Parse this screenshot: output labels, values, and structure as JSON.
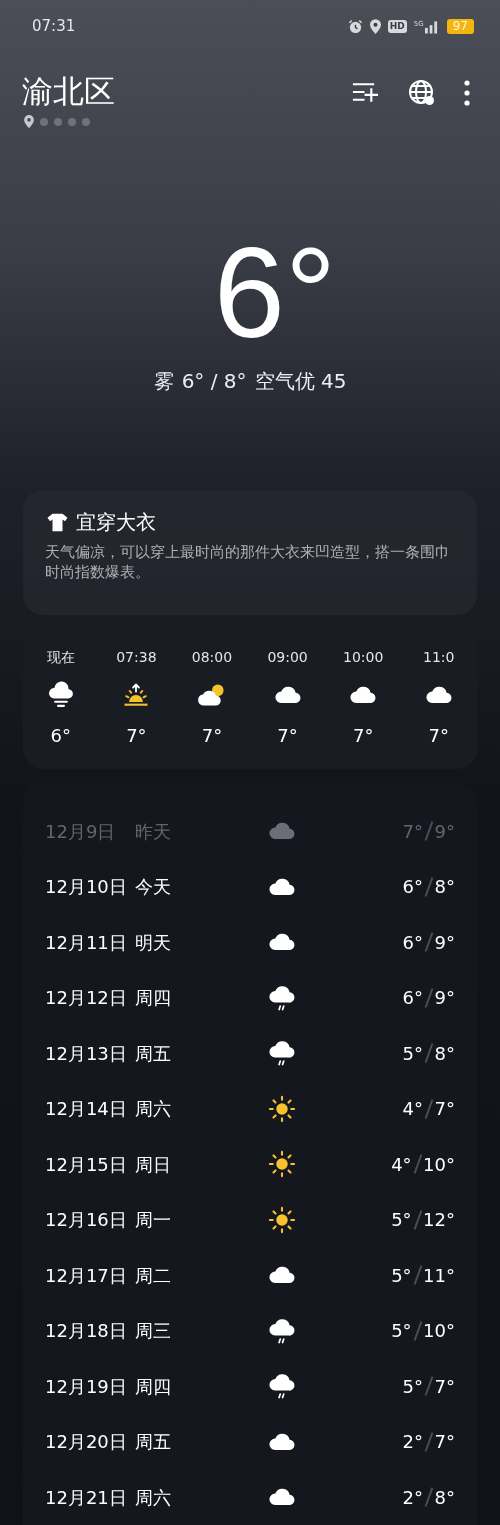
{
  "status_bar": {
    "time": "07:31",
    "hd": "HD",
    "network": "5G",
    "battery": "97"
  },
  "header": {
    "city": "渝北区",
    "page_dots": [
      {
        "kind": "location",
        "selected": true
      },
      {
        "kind": "dot",
        "selected": false
      },
      {
        "kind": "dot",
        "selected": false
      },
      {
        "kind": "dot",
        "selected": false
      },
      {
        "kind": "dot",
        "selected": false
      }
    ]
  },
  "current": {
    "temperature": "6°",
    "condition": "雾",
    "range": "6° / 8°",
    "air_quality": "空气优 45"
  },
  "clothing": {
    "title": "宜穿大衣",
    "text": "天气偏凉，可以穿上最时尚的那件大衣来凹造型，搭一条围巾时尚指数爆表。"
  },
  "hourly": [
    {
      "time": "现在",
      "kind": "fog",
      "temp": "6°"
    },
    {
      "time": "07:38",
      "kind": "sunrise",
      "temp": "7°"
    },
    {
      "time": "08:00",
      "kind": "partly",
      "temp": "7°"
    },
    {
      "time": "09:00",
      "kind": "cloudy",
      "temp": "7°"
    },
    {
      "time": "10:00",
      "kind": "cloudy",
      "temp": "7°"
    },
    {
      "time": "11:0",
      "kind": "cloudy",
      "temp": "7°"
    }
  ],
  "daily": [
    {
      "date": "12月9日",
      "day": "昨天",
      "kind": "cloudy",
      "low": "7°",
      "high": "9°",
      "past": true
    },
    {
      "date": "12月10日",
      "day": "今天",
      "kind": "cloudy",
      "low": "6°",
      "high": "8°",
      "past": false
    },
    {
      "date": "12月11日",
      "day": "明天",
      "kind": "cloudy",
      "low": "6°",
      "high": "9°",
      "past": false
    },
    {
      "date": "12月12日",
      "day": "周四",
      "kind": "rain",
      "low": "6°",
      "high": "9°",
      "past": false
    },
    {
      "date": "12月13日",
      "day": "周五",
      "kind": "rain",
      "low": "5°",
      "high": "8°",
      "past": false
    },
    {
      "date": "12月14日",
      "day": "周六",
      "kind": "sunny",
      "low": "4°",
      "high": "7°",
      "past": false
    },
    {
      "date": "12月15日",
      "day": "周日",
      "kind": "sunny",
      "low": "4°",
      "high": "10°",
      "past": false
    },
    {
      "date": "12月16日",
      "day": "周一",
      "kind": "sunny",
      "low": "5°",
      "high": "12°",
      "past": false
    },
    {
      "date": "12月17日",
      "day": "周二",
      "kind": "cloudy",
      "low": "5°",
      "high": "11°",
      "past": false
    },
    {
      "date": "12月18日",
      "day": "周三",
      "kind": "rain",
      "low": "5°",
      "high": "10°",
      "past": false
    },
    {
      "date": "12月19日",
      "day": "周四",
      "kind": "rain",
      "low": "5°",
      "high": "7°",
      "past": false
    },
    {
      "date": "12月20日",
      "day": "周五",
      "kind": "cloudy",
      "low": "2°",
      "high": "7°",
      "past": false
    },
    {
      "date": "12月21日",
      "day": "周六",
      "kind": "cloudy",
      "low": "2°",
      "high": "8°",
      "past": false
    }
  ]
}
